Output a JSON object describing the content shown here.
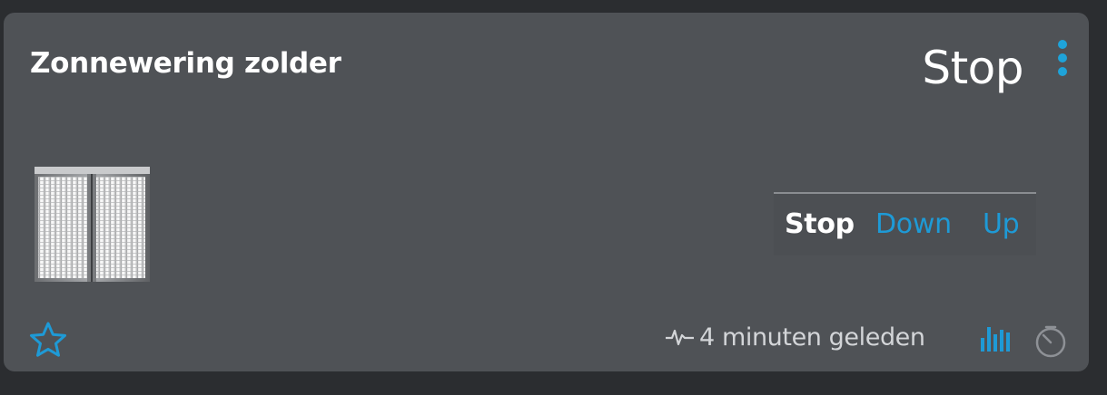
{
  "device": {
    "name": "Zonnewering zolder",
    "status": "Stop"
  },
  "controls": {
    "stop_label": "Stop",
    "down_label": "Down",
    "up_label": "Up",
    "active": "Stop"
  },
  "footer": {
    "last_update": "4 minuten geleden"
  },
  "icons": {
    "menu": "vertical-dots-icon",
    "device": "blinds-icon",
    "favorite": "star-outline-icon",
    "activity": "pulse-icon",
    "log": "bar-chart-icon",
    "timer": "timer-icon"
  },
  "colors": {
    "card_background": "#4f5256",
    "page_background": "#2b2d30",
    "accent": "#1ea3d9",
    "text": "#ffffff",
    "muted_icon": "#8e9196"
  }
}
